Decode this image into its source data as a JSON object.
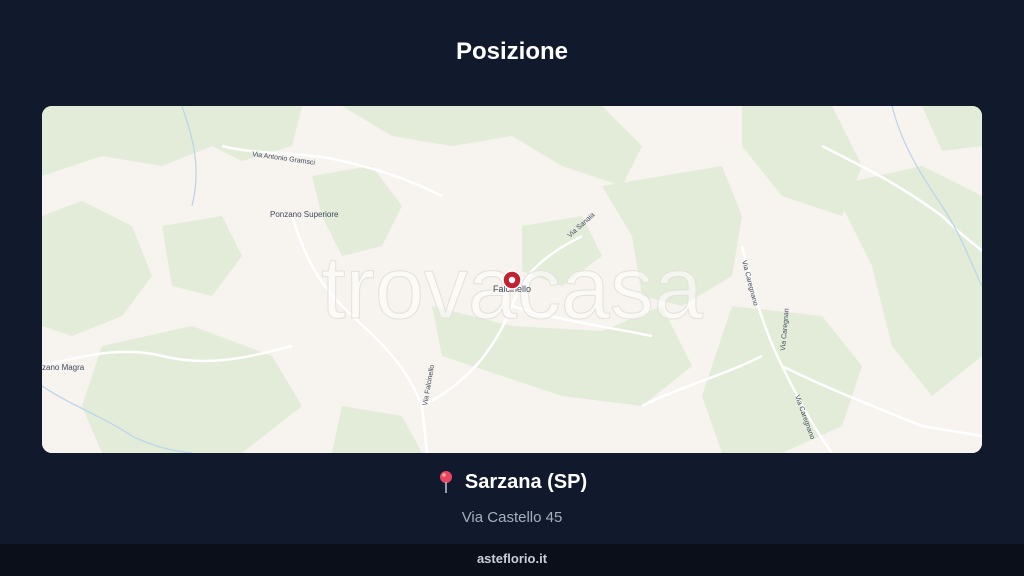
{
  "page": {
    "title": "Posizione"
  },
  "map": {
    "watermark": "trovacasa",
    "marker_label": "Falcinello",
    "place_labels": [
      "Via Antonio Gramsci",
      "Ponzano Superiore",
      "Via Sanaia",
      "Via Caregnano",
      "Via Falcinello",
      "Via Caregnan",
      "Via Caregnano",
      "zano Magra"
    ],
    "colors": {
      "land": "#f7f3ee",
      "forest": "#e2ecd9",
      "marker": "#c02233"
    }
  },
  "location": {
    "pin_icon": "map-pin-icon",
    "city": "Sarzana (SP)",
    "address": "Via Castello 45"
  },
  "footer": {
    "site": "asteflorio.it"
  }
}
